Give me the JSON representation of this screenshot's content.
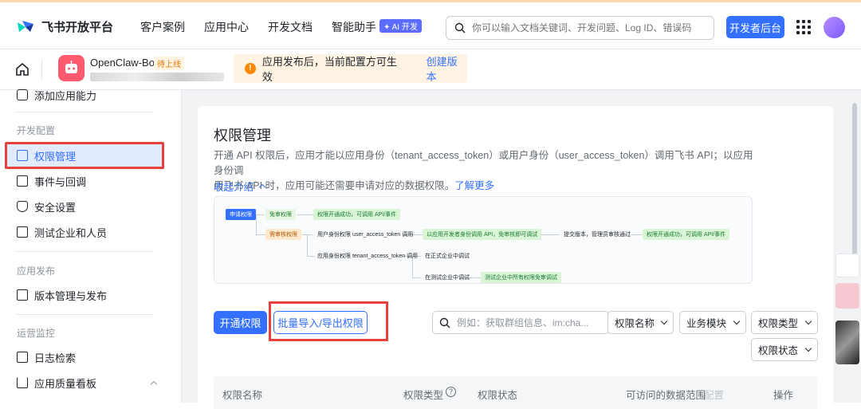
{
  "header": {
    "brand": "飞书开放平台",
    "nav": [
      "客户案例",
      "应用中心",
      "开发文档",
      "智能助手"
    ],
    "ai_badge": "✦ AI 开发",
    "search_placeholder": "你可以输入文档关键词、开发问题、Log ID、错误码",
    "dev_console": "开发者后台"
  },
  "app": {
    "name": "OpenClaw-Bot",
    "status": "待上线",
    "notice": "应用发布后，当前配置方可生效",
    "notice_link": "创建版本"
  },
  "sidebar": {
    "top_item": "添加应用能力",
    "groups": [
      {
        "title": "开发配置",
        "items": [
          "权限管理",
          "事件与回调",
          "安全设置",
          "测试企业和人员"
        ]
      },
      {
        "title": "应用发布",
        "items": [
          "版本管理与发布"
        ]
      },
      {
        "title": "运营监控",
        "items": [
          "日志检索",
          "应用质量看板"
        ]
      }
    ],
    "active": "权限管理"
  },
  "main": {
    "title": "权限管理",
    "desc_line1": "开通 API 权限后，应用才能以应用身份（tenant_access_token）或用户身份（user_access_token）调用飞书 API；以应用身份调",
    "desc_line2": "用飞书 API 时，应用可能还需要申请对应的数据权限。",
    "learn_more": "了解更多",
    "collapse": "收起介绍",
    "flow": {
      "apply": "申请权限",
      "free": "免审权限",
      "review": "需审核权限",
      "success1": "权限开通成功，可调用 API/事件",
      "user_perm": "用户身份权限 user_access_token 调用",
      "dev_call": "以应用开发者身份调用 API，免审核即可调试",
      "submit": "提交版本，管理员审核通过",
      "success2": "权限开通成功，可调用 API/事件",
      "app_perm": "应用身份权限 tenant_access_token 调用",
      "formal": "在正式企业中调试",
      "test": "在测试企业中调试",
      "test_free": "测试企业中所有权限免审调试"
    },
    "open_btn": "开通权限",
    "batch_btn": "批量导入/导出权限",
    "perm_search_placeholder": "例如：获取群组信息、im:cha...",
    "filters": [
      "权限名称",
      "业务模块",
      "权限类型",
      "权限状态"
    ],
    "table_headers": [
      "权限名称",
      "权限类型",
      "权限状态",
      "可访问的数据范围",
      "配置",
      "操作"
    ]
  }
}
